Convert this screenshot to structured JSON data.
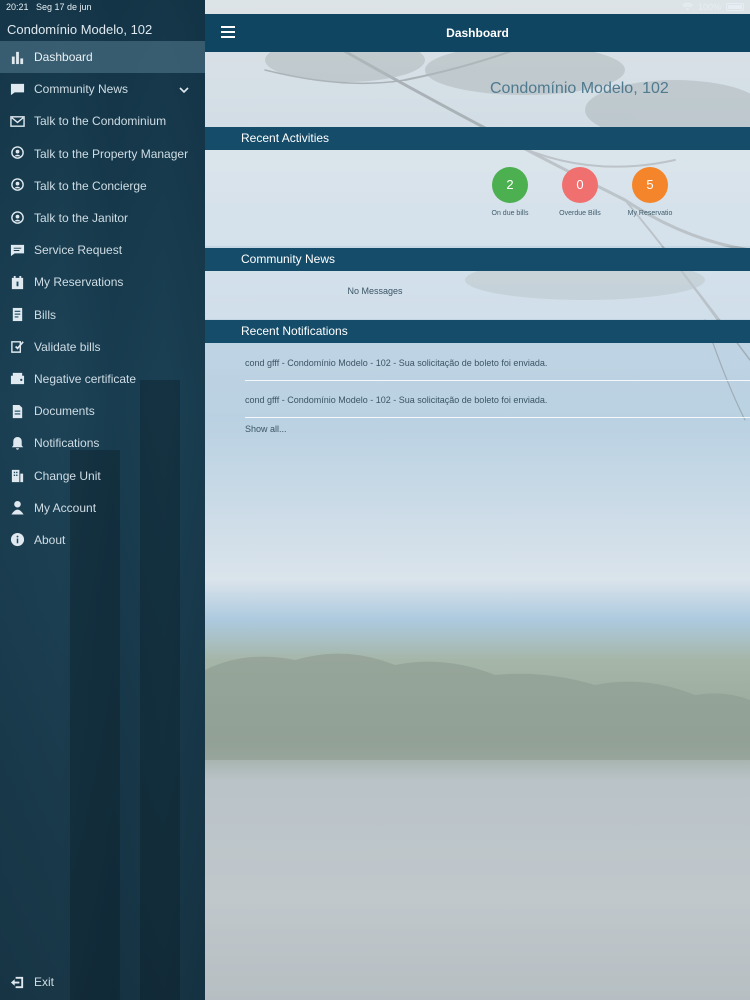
{
  "status": {
    "time": "20:21",
    "date": "Seg 17 de jun",
    "battery": "100%"
  },
  "sidebar": {
    "title": "Condomínio Modelo, 102",
    "items": [
      {
        "label": "Dashboard",
        "icon": "bar-chart-icon"
      },
      {
        "label": "Community News",
        "icon": "chat-icon"
      },
      {
        "label": "Talk to the Condominium",
        "icon": "mail-icon"
      },
      {
        "label": "Talk to the Property Manager",
        "icon": "person-chat-icon"
      },
      {
        "label": "Talk to the Concierge",
        "icon": "person-chat-icon"
      },
      {
        "label": "Talk to the Janitor",
        "icon": "person-chat-icon"
      },
      {
        "label": "Service Request",
        "icon": "message-icon"
      },
      {
        "label": "My Reservations",
        "icon": "calendar-icon"
      },
      {
        "label": "Bills",
        "icon": "bill-icon"
      },
      {
        "label": "Validate bills",
        "icon": "validate-icon"
      },
      {
        "label": "Negative certificate",
        "icon": "wallet-icon"
      },
      {
        "label": "Documents",
        "icon": "document-icon"
      },
      {
        "label": "Notifications",
        "icon": "bell-icon"
      },
      {
        "label": "Change Unit",
        "icon": "building-icon"
      },
      {
        "label": "My Account",
        "icon": "user-icon"
      },
      {
        "label": "About",
        "icon": "info-icon"
      }
    ],
    "exit_label": "Exit"
  },
  "header": {
    "title": "Dashboard"
  },
  "main": {
    "condo_name": "Condomínio Modelo, 102",
    "recent_activities": {
      "title": "Recent Activities",
      "stats": [
        {
          "value": "2",
          "label": "On due bills",
          "color": "#4caf50"
        },
        {
          "value": "0",
          "label": "Overdue Bills",
          "color": "#f07070"
        },
        {
          "value": "5",
          "label": "My Reservatio",
          "color": "#f5852a"
        }
      ]
    },
    "community_news": {
      "title": "Community News",
      "empty": "No Messages"
    },
    "recent_notifications": {
      "title": "Recent Notifications",
      "items": [
        "cond gfff - Condomínio Modelo - 102 - Sua solicitação de boleto foi enviada.",
        "cond gfff - Condomínio Modelo - 102 - Sua solicitação de boleto foi enviada."
      ],
      "show_all": "Show all..."
    }
  }
}
